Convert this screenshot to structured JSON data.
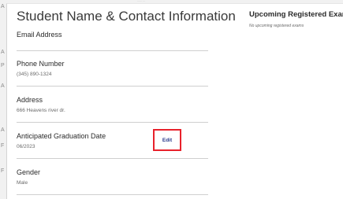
{
  "top_fragment": "…… …",
  "edge_letters": [
    "A",
    "A",
    "P",
    "A",
    "A",
    "F",
    "F"
  ],
  "profile": {
    "title": "Student Name & Contact Information",
    "fields": [
      {
        "label": "Email Address",
        "value": ""
      },
      {
        "label": "Phone Number",
        "value": "(345) 890-1324"
      },
      {
        "label": "Address",
        "value": "666 Heavens river dr."
      },
      {
        "label": "Anticipated Graduation Date",
        "value": "06/2023"
      },
      {
        "label": "Gender",
        "value": "Male"
      }
    ],
    "edit_label": "Edit"
  },
  "exams": {
    "title": "Upcoming Registered Exams",
    "empty_message": "No upcoming registered exams"
  },
  "colors": {
    "highlight": "#e8212b",
    "link": "#2a3a8c"
  }
}
